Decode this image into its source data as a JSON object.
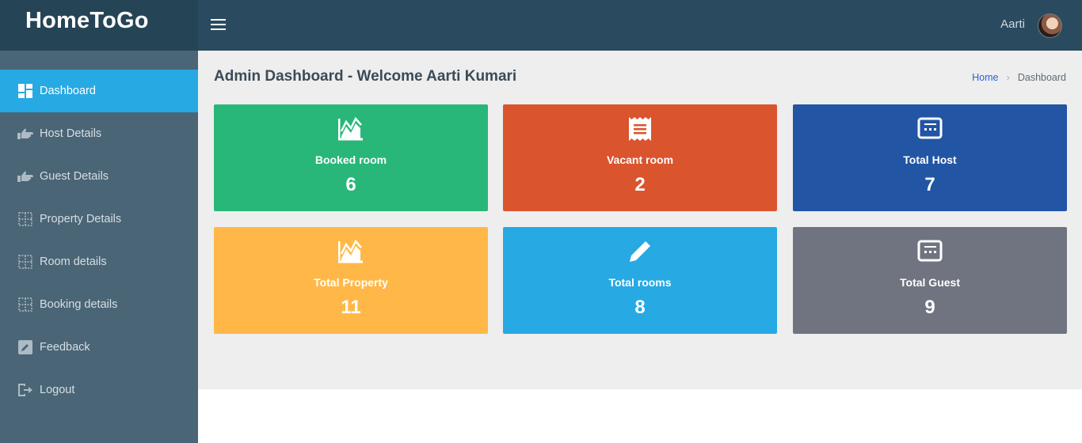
{
  "header": {
    "brand": "HomeToGo",
    "user_name": "Aarti"
  },
  "sidebar": {
    "items": [
      {
        "label": "Dashboard",
        "icon": "dashboard-icon",
        "active": true
      },
      {
        "label": "Host Details",
        "icon": "hand-point-icon"
      },
      {
        "label": "Guest Details",
        "icon": "hand-point-icon"
      },
      {
        "label": "Property Details",
        "icon": "grid-icon"
      },
      {
        "label": "Room details",
        "icon": "grid-icon"
      },
      {
        "label": "Booking details",
        "icon": "grid-icon"
      },
      {
        "label": "Feedback",
        "icon": "edit-icon"
      },
      {
        "label": "Logout",
        "icon": "logout-icon"
      }
    ]
  },
  "main": {
    "title": "Admin Dashboard - Welcome Aarti Kumari",
    "breadcrumb": {
      "home": "Home",
      "current": "Dashboard"
    }
  },
  "cards": [
    {
      "label": "Booked room",
      "value": "6",
      "icon": "chart-icon",
      "color": "#28b779"
    },
    {
      "label": "Vacant room",
      "value": "2",
      "icon": "receipt-icon",
      "color": "#da542e"
    },
    {
      "label": "Total Host",
      "value": "7",
      "icon": "screen-icon",
      "color": "#2255a4"
    },
    {
      "label": "Total Property",
      "value": "11",
      "icon": "chart-icon",
      "color": "#ffb848"
    },
    {
      "label": "Total rooms",
      "value": "8",
      "icon": "pencil-icon",
      "color": "#27a9e3"
    },
    {
      "label": "Total Guest",
      "value": "9",
      "icon": "screen-icon",
      "color": "#6f7480"
    }
  ]
}
